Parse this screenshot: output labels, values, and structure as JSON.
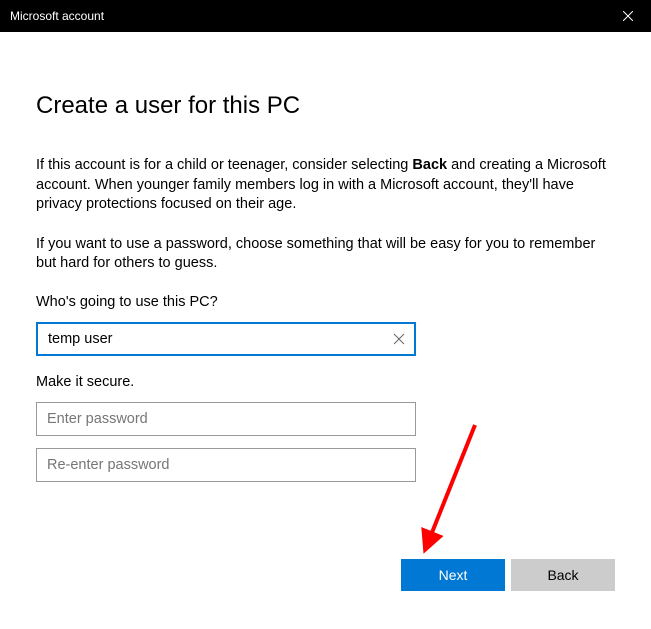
{
  "titlebar": {
    "title": "Microsoft account"
  },
  "heading": "Create a user for this PC",
  "para1_pre": "If this account is for a child or teenager, consider selecting ",
  "para1_bold": "Back",
  "para1_post": " and creating a Microsoft account. When younger family members log in with a Microsoft account, they'll have privacy protections focused on their age.",
  "para2": "If you want to use a password, choose something that will be easy for you to remember but hard for others to guess.",
  "username": {
    "label": "Who's going to use this PC?",
    "value": "temp user"
  },
  "secure_label": "Make it secure.",
  "password1": {
    "placeholder": "Enter password",
    "value": ""
  },
  "password2": {
    "placeholder": "Re-enter password",
    "value": ""
  },
  "buttons": {
    "next": "Next",
    "back": "Back"
  }
}
